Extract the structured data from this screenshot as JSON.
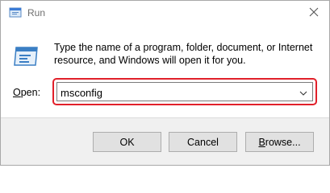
{
  "window": {
    "title": "Run",
    "close_glyph": "✕"
  },
  "dialog": {
    "description": "Type the name of a program, folder, document, or Internet resource, and Windows will open it for you.",
    "open_label_accel": "O",
    "open_label_rest": "pen:",
    "input_value": "msconfig"
  },
  "buttons": {
    "ok": "OK",
    "cancel": "Cancel",
    "browse_accel": "B",
    "browse_rest": "rowse..."
  },
  "colors": {
    "highlight_border": "#e1202a",
    "button_bar": "#f0f0f0"
  },
  "icons": [
    "run-app-icon",
    "close-icon",
    "run-large-icon",
    "chevron-down-icon"
  ]
}
